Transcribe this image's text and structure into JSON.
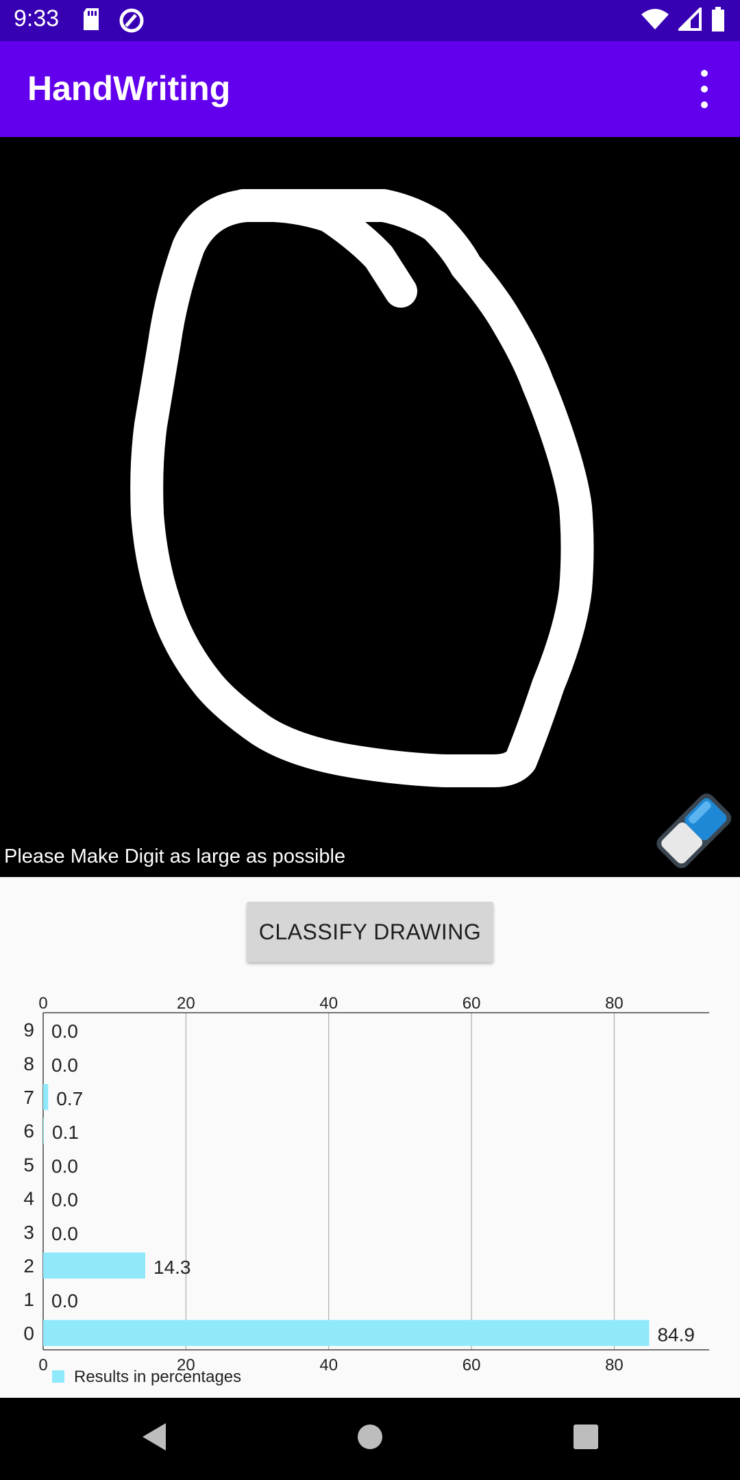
{
  "status_bar": {
    "time": "9:33",
    "left_icons": [
      "sd-card-icon",
      "sync-icon"
    ],
    "right_icons": [
      "wifi-icon",
      "cell-signal-icon",
      "battery-icon"
    ],
    "background": "#3700b3"
  },
  "app_bar": {
    "title": "HandWriting",
    "menu_icon": "more-vertical-icon",
    "background": "#6200ee"
  },
  "canvas": {
    "hint": "Please Make Digit as large as possible",
    "background": "#000000",
    "stroke_color": "#ffffff",
    "eraser_icon": "eraser-icon"
  },
  "classify_button": {
    "label": "CLASSIFY DRAWING"
  },
  "chart_data": {
    "type": "bar",
    "orientation": "horizontal",
    "categories": [
      "0",
      "1",
      "2",
      "3",
      "4",
      "5",
      "6",
      "7",
      "8",
      "9"
    ],
    "series": [
      {
        "name": "Results in percentages",
        "values": [
          84.9,
          0.0,
          14.3,
          0.0,
          0.0,
          0.0,
          0.1,
          0.7,
          0.0,
          0.0
        ],
        "color": "#8fe9fb"
      }
    ],
    "value_labels": [
      "84.9",
      "0.0",
      "14.3",
      "0.0",
      "0.0",
      "0.0",
      "0.1",
      "0.7",
      "0.0",
      "0.0"
    ],
    "xticks": [
      "0",
      "20",
      "40",
      "60",
      "80"
    ],
    "xlim": [
      0,
      93.3
    ],
    "grid": true,
    "legend_position": "bottom-left"
  },
  "nav_bar": {
    "back": "back-icon",
    "home": "home-icon",
    "recents": "recents-icon"
  }
}
